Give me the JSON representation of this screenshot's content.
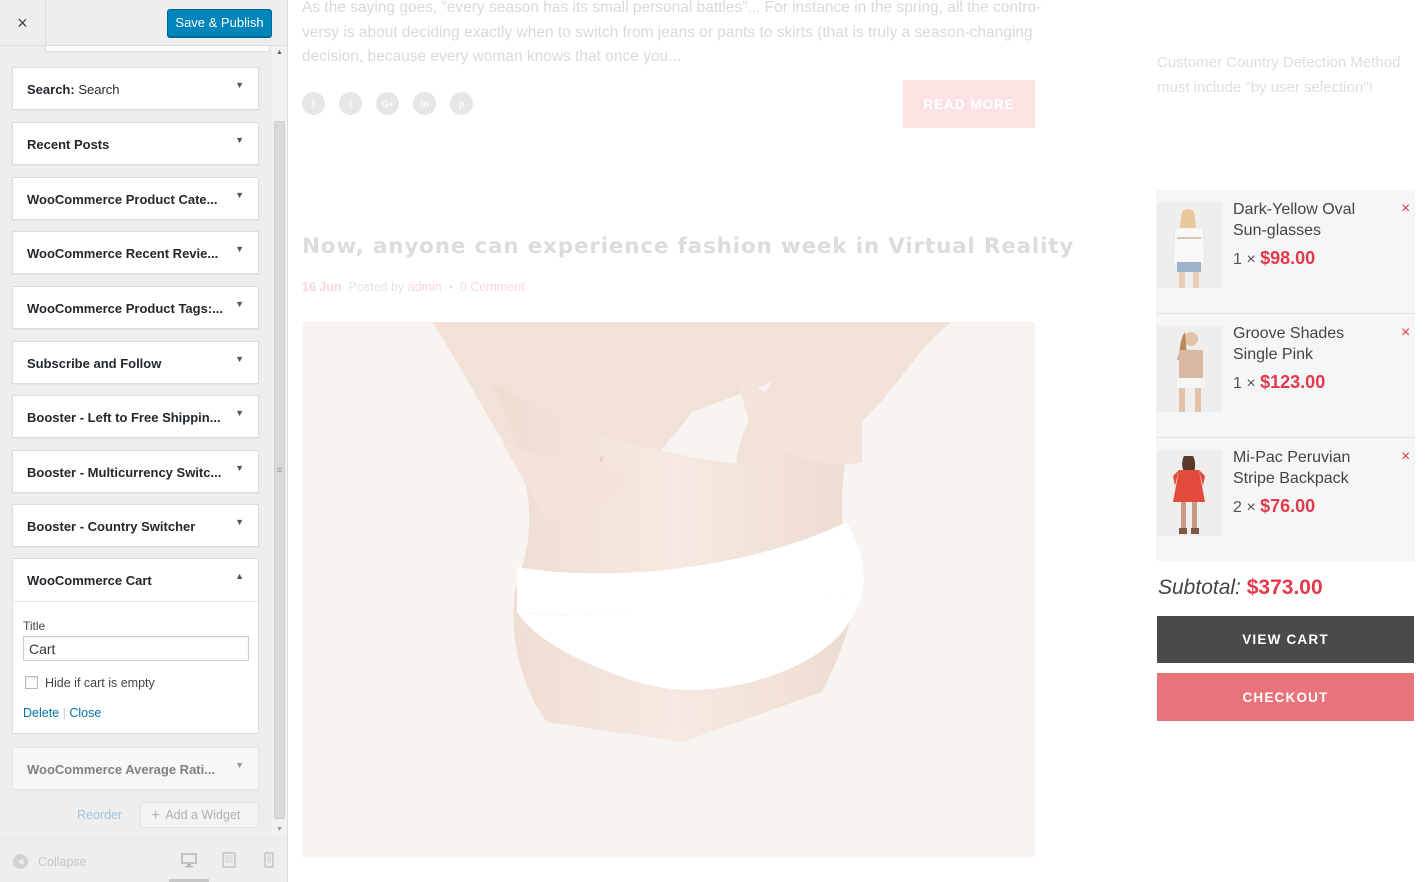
{
  "customizer": {
    "close_icon": "×",
    "save_label": "Save & Publish",
    "widgets": [
      {
        "label": "Search:",
        "sub": " Search"
      },
      {
        "label": "Recent Posts"
      },
      {
        "label": "WooCommerce Product Cate..."
      },
      {
        "label": "WooCommerce Recent Revie..."
      },
      {
        "label": "WooCommerce Product Tags:..."
      },
      {
        "label": "Subscribe and Follow"
      },
      {
        "label": "Booster - Left to Free Shippin..."
      },
      {
        "label": "Booster - Multicurrency Switc..."
      },
      {
        "label": "Booster - Country Switcher"
      }
    ],
    "open_widget": {
      "label": "WooCommerce Cart",
      "title_label": "Title",
      "title_value": "Cart",
      "hide_label": "Hide if cart is empty",
      "hide_checked": false,
      "delete_label": "Delete",
      "separator": "|",
      "close_label": "Close"
    },
    "next_widget": {
      "label": "WooCommerce Average Rati..."
    },
    "reorder_label": "Reorder",
    "add_widget_label": "Add a Widget",
    "collapse_label": "Collapse"
  },
  "preview": {
    "excerpt": "As the saying goes, “every season has its small personal battles”... For instance in the spring, all the contro-versy is about deciding exactly when to switch from jeans or pants to skirts (that is truly a season-changing decision, because every woman knows that once you...",
    "socials": [
      "f",
      "t",
      "G+",
      "in",
      "p"
    ],
    "read_more": "READ MORE",
    "post_title": "Now, anyone can experience fashion week in Virtual Reality",
    "post_date": "16 Jun",
    "posted_by": "Posted by",
    "author": "admin",
    "bullet": "•",
    "comments": "0 Comment",
    "notice": "Customer Country Detection Method must include \"by user selection\"!"
  },
  "cart": {
    "items": [
      {
        "name": "Dark-Yellow Oval Sun-glasses",
        "qty": "1 ×",
        "price": "$98.00"
      },
      {
        "name": "Groove Shades Single Pink",
        "qty": "1 ×",
        "price": "$123.00"
      },
      {
        "name": "Mi-Pac Peruvian Stripe Backpack",
        "qty": "2 ×",
        "price": "$76.00"
      }
    ],
    "remove_icon": "×",
    "subtotal_label": "Subtotal:",
    "subtotal_value": "$373.00",
    "view_cart": "VIEW CART",
    "checkout": "CHECKOUT"
  },
  "colors": {
    "primary_button": "#0085ba",
    "price_red": "#e33a4b",
    "checkout_pink": "#e9737a",
    "view_cart_dark": "#4a4a4c"
  }
}
